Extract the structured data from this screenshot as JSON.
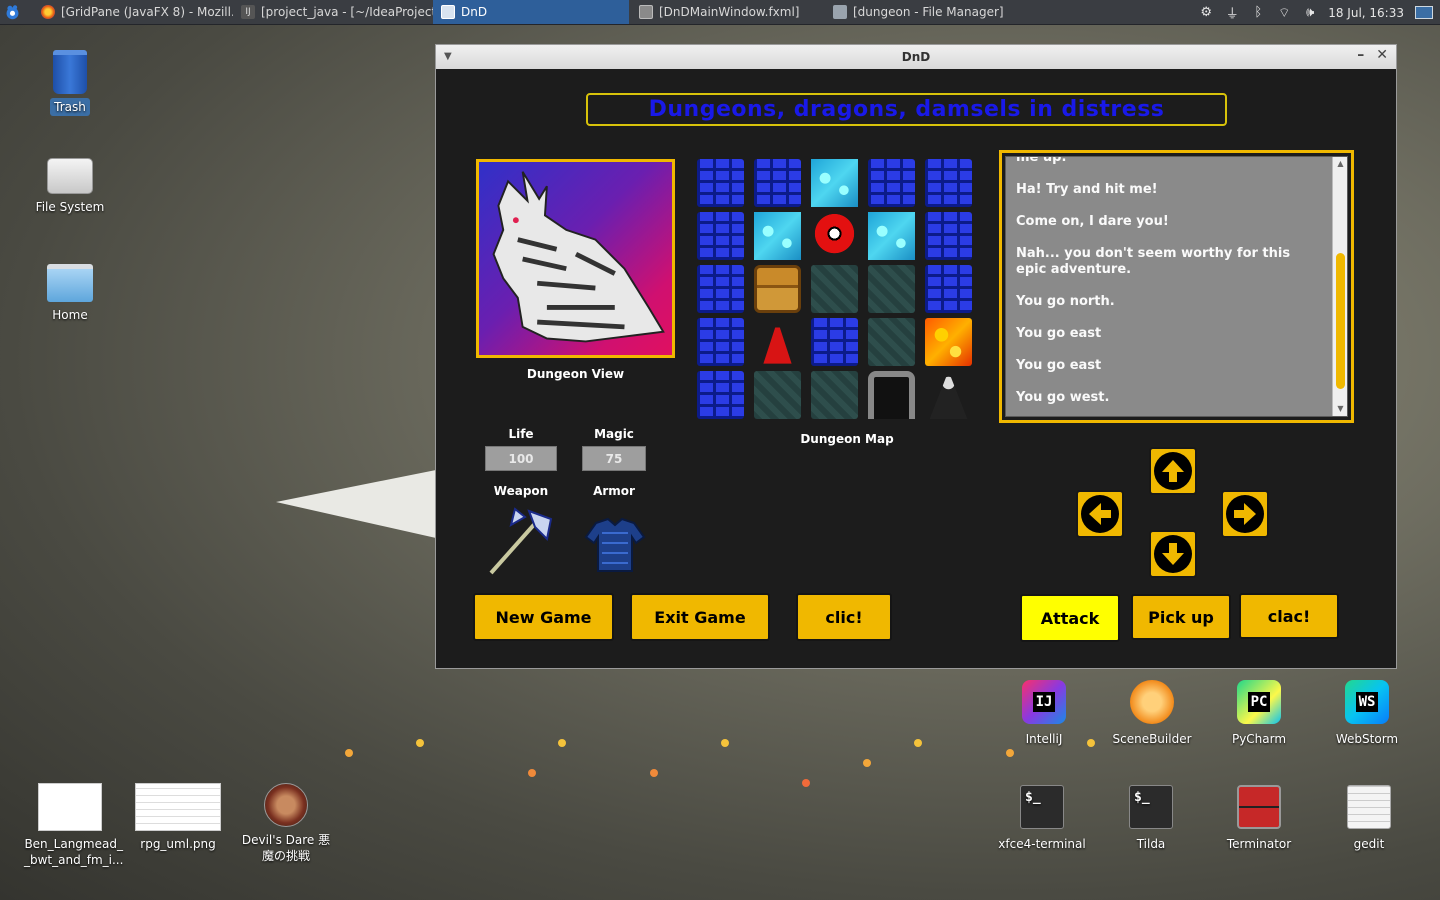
{
  "panel": {
    "tasks": [
      {
        "label": "[GridPane (JavaFX 8) - Mozill...",
        "icon": "firefox-icon",
        "active": false
      },
      {
        "label": "[project_java - [~/IdeaProject...",
        "icon": "intellij-icon",
        "active": false
      },
      {
        "label": "DnD",
        "icon": "window-icon",
        "active": true
      },
      {
        "label": "[DnDMainWindow.fxml]",
        "icon": "window-icon",
        "active": false
      },
      {
        "label": "[dungeon - File Manager]",
        "icon": "folder-icon",
        "active": false
      }
    ],
    "clock": "18 Jul, 16:33"
  },
  "desktop": {
    "trash": "Trash",
    "filesystem": "File System",
    "home": "Home",
    "files": [
      {
        "label": "Ben_Langmead_\n_bwt_and_fm_i..."
      },
      {
        "label": "rpg_uml.png"
      },
      {
        "label": "Devil's Dare 悪\n魔の挑戦"
      }
    ],
    "apps_top": [
      "IntelliJ",
      "SceneBuilder",
      "PyCharm",
      "WebStorm"
    ],
    "apps_bottom": [
      "xfce4-terminal",
      "Tilda",
      "Terminator",
      "gedit"
    ],
    "app_glyphs": {
      "intellij": "IJ",
      "pycharm": "PC",
      "webstorm": "WS",
      "terminal": "$_"
    }
  },
  "window": {
    "title": "DnD",
    "banner": "Dungeons, dragons, damsels in distress",
    "dungeon_view_label": "Dungeon View",
    "dungeon_map_label": "Dungeon Map",
    "stats": {
      "life_label": "Life",
      "life_value": "100",
      "magic_label": "Magic",
      "magic_value": "75",
      "weapon_label": "Weapon",
      "armor_label": "Armor"
    },
    "map_tiles": [
      [
        "wall",
        "wall",
        "water",
        "wall",
        "wall"
      ],
      [
        "wall",
        "water",
        "eye-monster",
        "water",
        "wall"
      ],
      [
        "wall",
        "chest",
        "floor",
        "floor",
        "wall"
      ],
      [
        "wall",
        "wizard",
        "wall",
        "floor",
        "lava"
      ],
      [
        "wall",
        "floor",
        "floor",
        "doorway",
        "reaper"
      ]
    ],
    "log": {
      "partial_first_line": "me up.",
      "messages": [
        "Ha! Try and hit me!",
        "Come on, I dare you!",
        "Nah... you don't seem worthy for this epic adventure.",
        "You go north.",
        "You go east",
        "You go east",
        "You go west."
      ],
      "scroll_position": 0.9
    },
    "buttons": {
      "new_game": "New Game",
      "exit_game": "Exit Game",
      "clic": "clic!",
      "attack": "Attack",
      "pick_up": "Pick up",
      "clac": "clac!"
    },
    "colors": {
      "accent": "#f0b800",
      "banner_text": "#1919e8",
      "attack_button": "#ffff00",
      "background": "#1c1c1c"
    }
  }
}
